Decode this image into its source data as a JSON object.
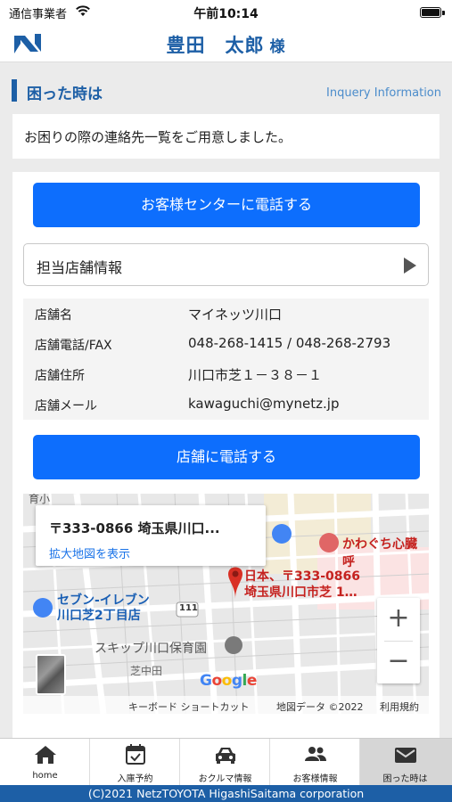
{
  "status_bar": {
    "carrier": "通信事業者",
    "time": "午前10:14"
  },
  "header": {
    "user_name": "豊田　太郎",
    "honorific": "様"
  },
  "section": {
    "title": "困った時は",
    "subtitle": "Inquery Information"
  },
  "intro_text": "お困りの際の連絡先一覧をご用意しました。",
  "buttons": {
    "call_center": "お客様センターに電話する",
    "call_store": "店舗に電話する"
  },
  "store_toggle": {
    "label": "担当店舗情報"
  },
  "store_info": [
    {
      "key": "店舗名",
      "value": "マイネッツ川口"
    },
    {
      "key": "店舗電話/FAX",
      "value": "048-268-1415 / 048-268-2793"
    },
    {
      "key": "店舗住所",
      "value": "川口市芝１－３８－１"
    },
    {
      "key": "店舗メール",
      "value": "kawaguchi@mynetz.jp"
    }
  ],
  "map": {
    "popup_address": "〒333-0866 埼玉県川口...",
    "popup_link": "拡大地図を表示",
    "pin_label_1": "日本、〒333-0866",
    "pin_label_2": "埼玉県川口市芝 1…",
    "poi_hospital": "かわぐち心臓呼",
    "poi_seven_1": "セブン-イレブン",
    "poi_seven_2": "川口芝2丁目店",
    "poi_nursery": "スキップ川口保育園",
    "poi_school": "育小",
    "area_label": "芝中田",
    "route_number": "111",
    "google_letters": [
      "G",
      "o",
      "o",
      "g",
      "l",
      "e"
    ],
    "footer_shortcuts": "キーボード ショートカット",
    "footer_data": "地図データ ©2022",
    "footer_terms": "利用規約",
    "zoom_in": "+",
    "zoom_out": "−"
  },
  "tabs": [
    {
      "label": "home",
      "icon": "home-icon"
    },
    {
      "label": "入庫予約",
      "icon": "calendar-check-icon"
    },
    {
      "label": "おクルマ情報",
      "icon": "car-icon"
    },
    {
      "label": "お客様情報",
      "icon": "people-icon"
    },
    {
      "label": "困った時は",
      "icon": "mail-icon",
      "active": true
    }
  ],
  "footer": "(C)2021 NetzTOYOTA HigashiSaitama corporation",
  "colors": {
    "brand_blue": "#1d5fa6",
    "button_blue": "#0d6efd",
    "pin_red": "#d93025"
  }
}
